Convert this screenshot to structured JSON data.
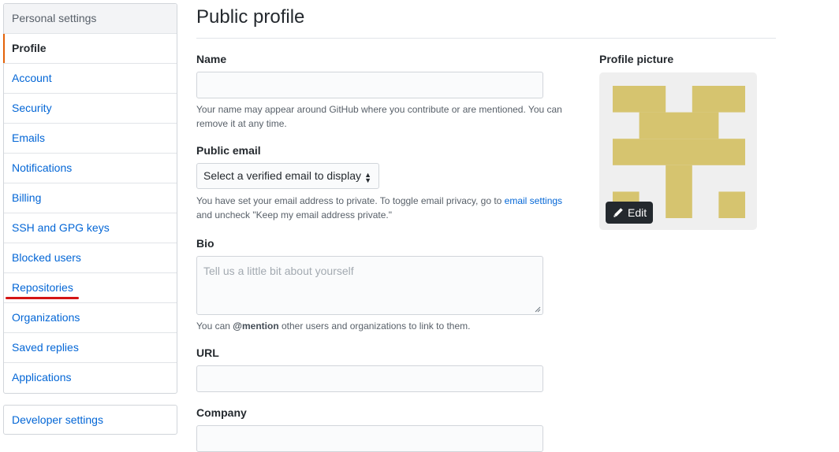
{
  "sidebar": {
    "header": "Personal settings",
    "items": [
      {
        "label": "Profile",
        "selected": true
      },
      {
        "label": "Account"
      },
      {
        "label": "Security"
      },
      {
        "label": "Emails"
      },
      {
        "label": "Notifications"
      },
      {
        "label": "Billing"
      },
      {
        "label": "SSH and GPG keys"
      },
      {
        "label": "Blocked users"
      },
      {
        "label": "Repositories",
        "annotated": true
      },
      {
        "label": "Organizations"
      },
      {
        "label": "Saved replies"
      },
      {
        "label": "Applications"
      }
    ],
    "developer_settings": "Developer settings"
  },
  "main": {
    "title": "Public profile",
    "name": {
      "label": "Name",
      "value": "",
      "note": "Your name may appear around GitHub where you contribute or are mentioned. You can remove it at any time."
    },
    "public_email": {
      "label": "Public email",
      "selected": "Select a verified email to display",
      "note_before": "You have set your email address to private. To toggle email privacy, go to",
      "note_link": "email settings",
      "note_after": "and uncheck \"Keep my email address private.\""
    },
    "bio": {
      "label": "Bio",
      "placeholder": "Tell us a little bit about yourself",
      "note_before": "You can",
      "note_mention": "@mention",
      "note_after": "other users and organizations to link to them."
    },
    "url": {
      "label": "URL",
      "value": ""
    },
    "company": {
      "label": "Company",
      "value": ""
    }
  },
  "profile_picture": {
    "label": "Profile picture",
    "edit_label": "Edit",
    "identicon_color": "#d6c46f",
    "background_color": "#efefef"
  },
  "colors": {
    "link": "#0366d6",
    "selected_marker": "#e36209",
    "annotation_underline": "#d41414"
  },
  "icons": {
    "edit": "pencil-icon",
    "select": "select-arrows-icon",
    "resize": "resize-grip-icon"
  }
}
